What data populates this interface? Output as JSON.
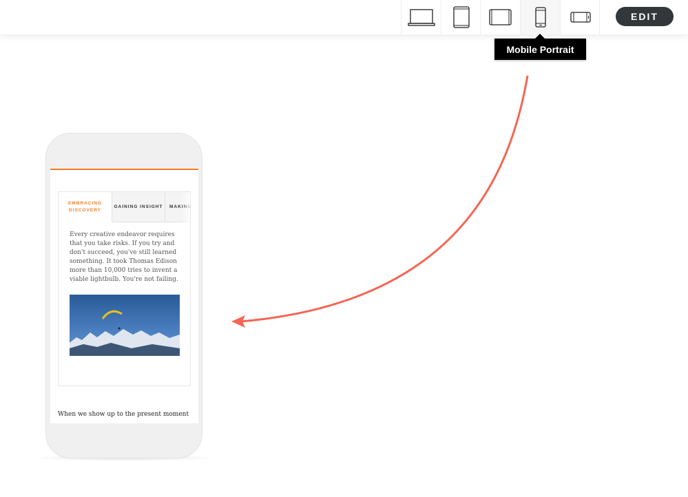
{
  "toolbar": {
    "devices": [
      {
        "name": "laptop",
        "label": "Desktop"
      },
      {
        "name": "tablet-portrait",
        "label": "Tablet Portrait"
      },
      {
        "name": "tablet-landscape",
        "label": "Tablet Landscape"
      },
      {
        "name": "mobile-portrait",
        "label": "Mobile Portrait",
        "active": true
      },
      {
        "name": "mobile-landscape",
        "label": "Mobile Landscape"
      }
    ],
    "edit_label": "EDIT",
    "tooltip": "Mobile Portrait"
  },
  "preview": {
    "tabs": [
      "EMBRACING DISCOVERY",
      "GAINING INSIGHT",
      "MAKING"
    ],
    "body": "Every creative endeavor requires that you take risks. If you try and don't succeed, you've still learned something. It took Thomas Edison more than 10,000 tries to invent a viable lightbulb. You're not failing.",
    "next_heading": "When we show up to the present moment"
  },
  "colors": {
    "accent": "#f47b20",
    "arrow": "#f56552",
    "edit_bg": "#33373a"
  }
}
